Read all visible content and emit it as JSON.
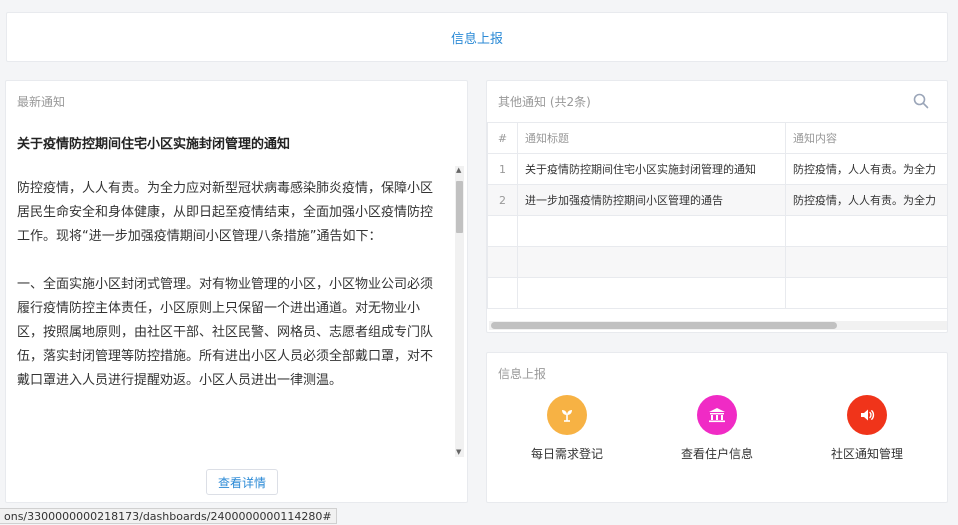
{
  "top": {
    "link_label": "信息上报"
  },
  "latest": {
    "header": "最新通知",
    "title": "关于疫情防控期间住宅小区实施封闭管理的通知",
    "paragraphs": [
      "防控疫情，人人有责。为全力应对新型冠状病毒感染肺炎疫情，保障小区居民生命安全和身体健康，从即日起至疫情结束，全面加强小区疫情防控工作。现将“进一步加强疫情期间小区管理八条措施”通告如下：",
      "一、全面实施小区封闭式管理。对有物业管理的小区，小区物业公司必须履行疫情防控主体责任，小区原则上只保留一个进出通道。对无物业小区，按照属地原则，由社区干部、社区民警、网格员、志愿者组成专门队伍，落实封闭管理等防控措施。所有进出小区人员必须全部戴口罩，对不戴口罩进入人员进行提醒劝返。小区人员进出一律测温。"
    ],
    "detail_button": "查看详情"
  },
  "other": {
    "header": "其他通知 (共2条)",
    "columns": [
      "#",
      "通知标题",
      "通知内容"
    ],
    "rows": [
      {
        "no": "1",
        "title": "关于疫情防控期间住宅小区实施封闭管理的通知",
        "content": "防控疫情，人人有责。为全力"
      },
      {
        "no": "2",
        "title": "进一步加强疫情防控期间小区管理的通告",
        "content": "防控疫情，人人有责。为全力"
      }
    ]
  },
  "report": {
    "header": "信息上报",
    "tiles": [
      {
        "label": "每日需求登记",
        "icon": "sprout-icon",
        "color": "#f7b244"
      },
      {
        "label": "查看住户信息",
        "icon": "bank-icon",
        "color": "#f02bc5"
      },
      {
        "label": "社区通知管理",
        "icon": "speaker-icon",
        "color": "#f0341a"
      }
    ]
  },
  "status_url": "ons/3300000000218173/dashboards/2400000000114280#"
}
